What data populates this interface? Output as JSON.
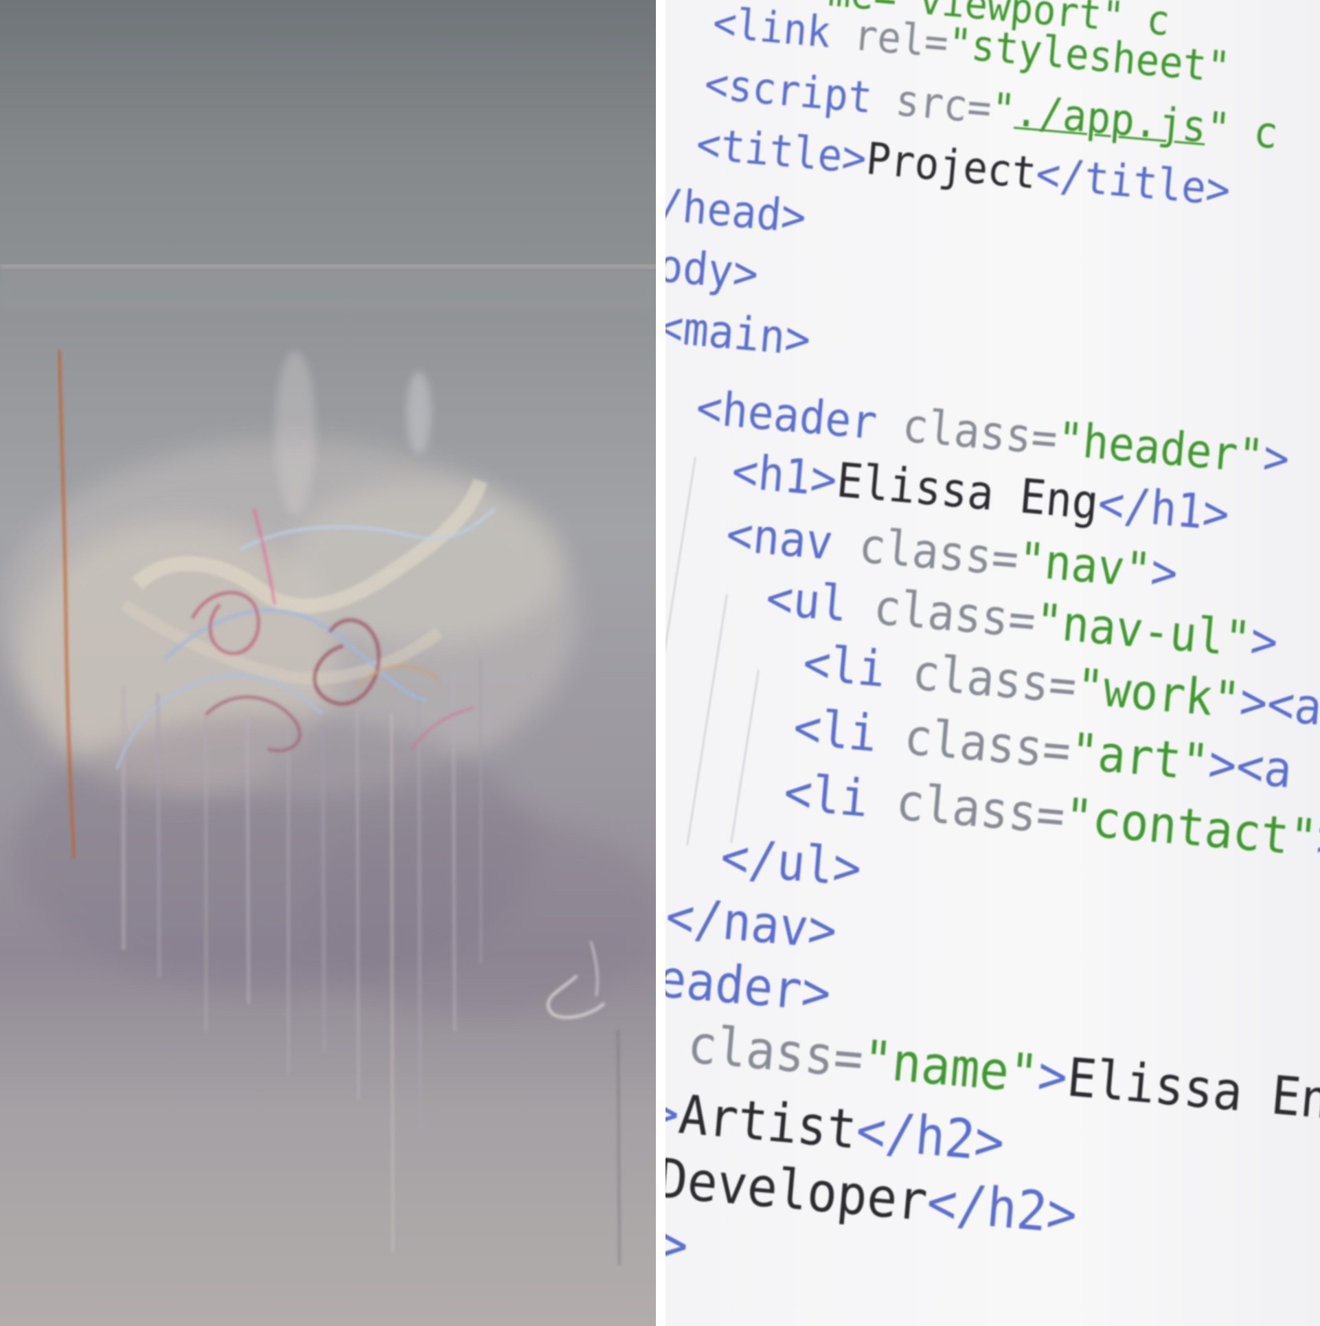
{
  "painting": {
    "description_icon": "abstract-painting"
  },
  "code_lines": [
    {
      "segments": [
        {
          "text": "me=\"viewport\" c",
          "cls": "s"
        }
      ]
    },
    {
      "segments": [
        {
          "text": "<link ",
          "cls": "t"
        },
        {
          "text": "rel=",
          "cls": "a"
        },
        {
          "text": "\"stylesheet\"",
          "cls": "s"
        }
      ]
    },
    {
      "segments": [
        {
          "text": "<script ",
          "cls": "t"
        },
        {
          "text": "src=",
          "cls": "a"
        },
        {
          "text": "\"",
          "cls": "s"
        },
        {
          "text": "./app.js",
          "cls": "s u"
        },
        {
          "text": "\" c",
          "cls": "s"
        }
      ]
    },
    {
      "segments": [
        {
          "text": "<title>",
          "cls": "t"
        },
        {
          "text": "Project",
          "cls": "x"
        },
        {
          "text": "</title>",
          "cls": "t"
        }
      ]
    },
    {
      "segments": [
        {
          "text": "/head>",
          "cls": "t"
        }
      ]
    },
    {
      "segments": [
        {
          "text": "ody>",
          "cls": "t"
        }
      ]
    },
    {
      "segments": [
        {
          "text": "<main>",
          "cls": "t"
        }
      ]
    },
    {
      "segments": [
        {
          "text": "<header ",
          "cls": "t"
        },
        {
          "text": "class=",
          "cls": "a"
        },
        {
          "text": "\"header\"",
          "cls": "s"
        },
        {
          "text": ">",
          "cls": "t"
        }
      ]
    },
    {
      "segments": [
        {
          "text": "<h1>",
          "cls": "t"
        },
        {
          "text": "Elissa Eng",
          "cls": "x"
        },
        {
          "text": "</h1>",
          "cls": "t"
        }
      ]
    },
    {
      "segments": [
        {
          "text": "<nav ",
          "cls": "t"
        },
        {
          "text": "class=",
          "cls": "a"
        },
        {
          "text": "\"nav\"",
          "cls": "s"
        },
        {
          "text": ">",
          "cls": "t"
        }
      ]
    },
    {
      "segments": [
        {
          "text": "<ul ",
          "cls": "t"
        },
        {
          "text": "class=",
          "cls": "a"
        },
        {
          "text": "\"nav-ul\"",
          "cls": "s"
        },
        {
          "text": ">",
          "cls": "t"
        }
      ]
    },
    {
      "segments": [
        {
          "text": "<li ",
          "cls": "t"
        },
        {
          "text": "class=",
          "cls": "a"
        },
        {
          "text": "\"work\"",
          "cls": "s"
        },
        {
          "text": "><a",
          "cls": "t"
        }
      ]
    },
    {
      "segments": [
        {
          "text": "<li ",
          "cls": "t"
        },
        {
          "text": "class=",
          "cls": "a"
        },
        {
          "text": "\"art\"",
          "cls": "s"
        },
        {
          "text": "><a h",
          "cls": "t"
        }
      ]
    },
    {
      "segments": [
        {
          "text": "<li ",
          "cls": "t"
        },
        {
          "text": "class=",
          "cls": "a"
        },
        {
          "text": "\"contact\"",
          "cls": "s"
        },
        {
          "text": ">",
          "cls": "t"
        }
      ]
    },
    {
      "segments": [
        {
          "text": "</ul>",
          "cls": "t"
        }
      ]
    },
    {
      "segments": [
        {
          "text": "</nav>",
          "cls": "t"
        }
      ]
    },
    {
      "segments": [
        {
          "text": "eader>",
          "cls": "t"
        }
      ]
    },
    {
      "segments": [
        {
          "text": "class=",
          "cls": "a"
        },
        {
          "text": "\"name\"",
          "cls": "s"
        },
        {
          "text": ">",
          "cls": "t"
        },
        {
          "text": "Elissa Eng",
          "cls": "x"
        },
        {
          "text": "<",
          "cls": "t"
        }
      ]
    },
    {
      "segments": [
        {
          "text": ">",
          "cls": "t"
        },
        {
          "text": "Artist",
          "cls": "x"
        },
        {
          "text": "</h2>",
          "cls": "t"
        }
      ]
    },
    {
      "segments": [
        {
          "text": "Developer",
          "cls": "x"
        },
        {
          "text": "</h2>",
          "cls": "t"
        }
      ]
    },
    {
      "segments": [
        {
          "text": ">",
          "cls": "t"
        }
      ]
    }
  ]
}
